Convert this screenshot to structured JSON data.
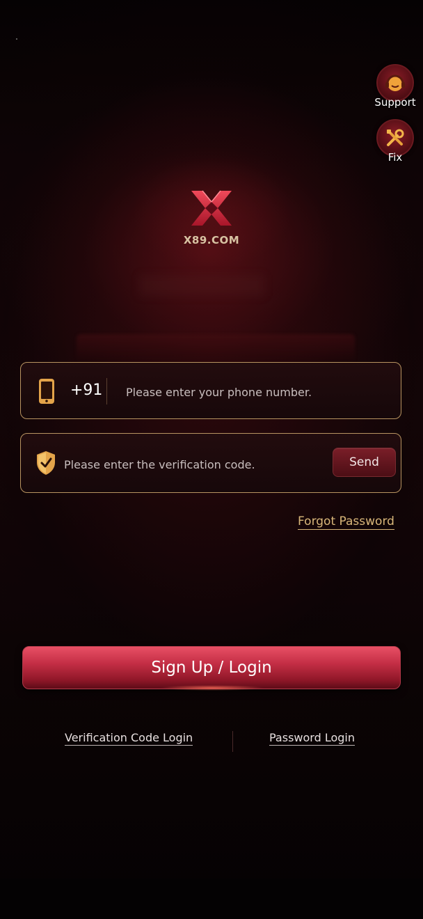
{
  "side_buttons": {
    "support_label": "Support",
    "fix_label": "Fix"
  },
  "brand": {
    "logo_text": "X89.COM",
    "logo_icon": "x-logo-icon",
    "primary_color": "#e0364a",
    "accent_gold": "#b89461"
  },
  "phone_field": {
    "icon": "phone-icon",
    "country_code": "+91",
    "value": "",
    "placeholder": "Please enter your phone number."
  },
  "code_field": {
    "icon": "shield-check-icon",
    "value": "",
    "placeholder": "Please enter the verification code.",
    "send_label": "Send"
  },
  "forgot_password_label": "Forgot Password",
  "login_button_label": "Sign Up / Login",
  "alt_logins": {
    "verification_code_label": "Verification Code Login",
    "password_label": "Password Login"
  }
}
